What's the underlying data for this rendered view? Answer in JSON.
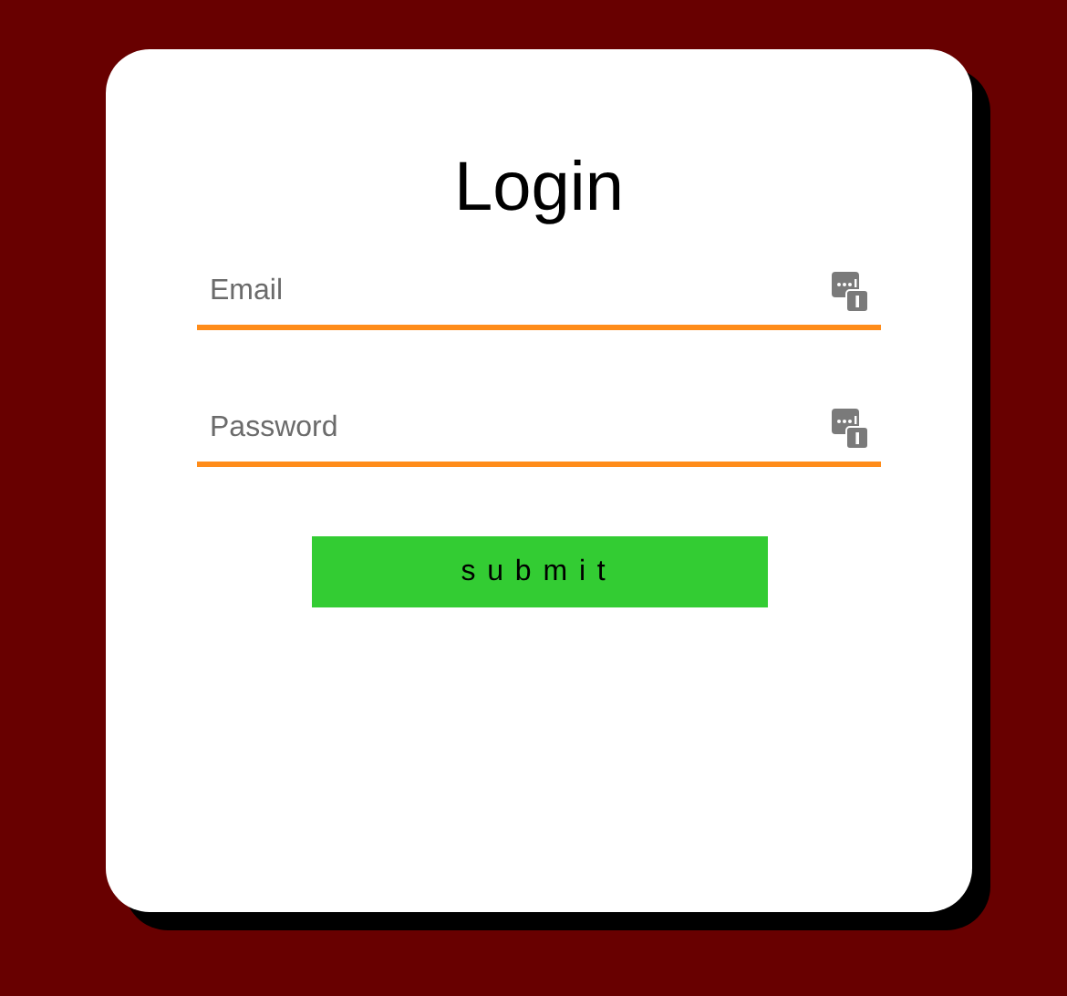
{
  "title": "Login",
  "fields": [
    {
      "placeholder": "Email"
    },
    {
      "placeholder": "Password"
    }
  ],
  "submit": "submit"
}
